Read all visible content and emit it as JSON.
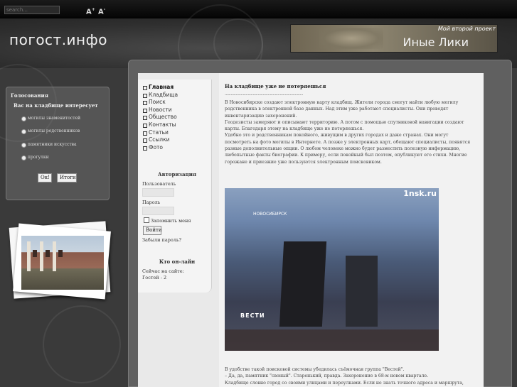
{
  "topbar": {
    "search_placeholder": "search...",
    "font_increase": "A",
    "font_decrease": "A"
  },
  "header": {
    "site_name": "погост.инфо",
    "banner_tag": "Мой второй проект",
    "banner_title": "Иные Лики"
  },
  "poll": {
    "title": "Голосования",
    "question": "Вас на кладбище интересует",
    "options": [
      "могилы знаменитостей",
      "могилы родственников",
      "памятники искусства",
      "прогулки"
    ],
    "vote_button": "Ок!",
    "results_button": "Итоги"
  },
  "menu": {
    "items": [
      "Главная",
      "Кладбища",
      "Поиск",
      "Новости",
      "Общество",
      "Контакты",
      "Статьи",
      "Ссылки",
      "Фото"
    ]
  },
  "auth": {
    "title": "Авторизация",
    "username_label": "Пользователь",
    "password_label": "Пароль",
    "remember_label": "Запомнить меня",
    "login_button": "Войти",
    "forgot_link": "Забыли пароль?"
  },
  "online": {
    "title": "Кто он-лайн",
    "now_label": "Сейчас на сайте:",
    "guests": "Гостей - 2"
  },
  "article": {
    "title": "На кладбище уже не потеряешься",
    "dots": "..............................................................................",
    "paragraphs": [
      "В Новосибирске создают электронную карту кладбищ. Жители города смогут найти любую могилу родственника в электронной базе данных. Над этим уже работают специалисты. Они проводят инвентаризацию захоронений.",
      "Геодезисты замеряют и описывают территорию. А потом с помощью спутниковой навигации создают карты. Благодаря этому на кладбище уже не потеряешься.",
      "Удобно это и родственникам покойного, живущим в других городах и даже странах. Они могут посмотреть на фото могилы в Интернете. А позже у электронных карт, обещают специалисты, появятся разные дополнительные опции. О любом человеке можно будет разместить полезную информацию, любопытные факты биографии. К примеру, если покойный был поэтом, опубликуют его стихи. Многие горожане и приезжие уже пользуются электронным поисковиком."
    ],
    "video_logo": "1nsk.ru",
    "video_city": "НОВОСИБИРСК",
    "video_channel": "ВЕСТИ",
    "footer_lines": [
      "В удобстве такой поисковой системы убедилась съёмочная группа \"Вестей\".",
      "– Да, да, памятник \"своный\". Старенький, правда. Захоронение в 68-м новом квартале.",
      "Кладбище словно город со своими улицами и переулками. Если не знать точного адреса и маршрута,"
    ]
  }
}
